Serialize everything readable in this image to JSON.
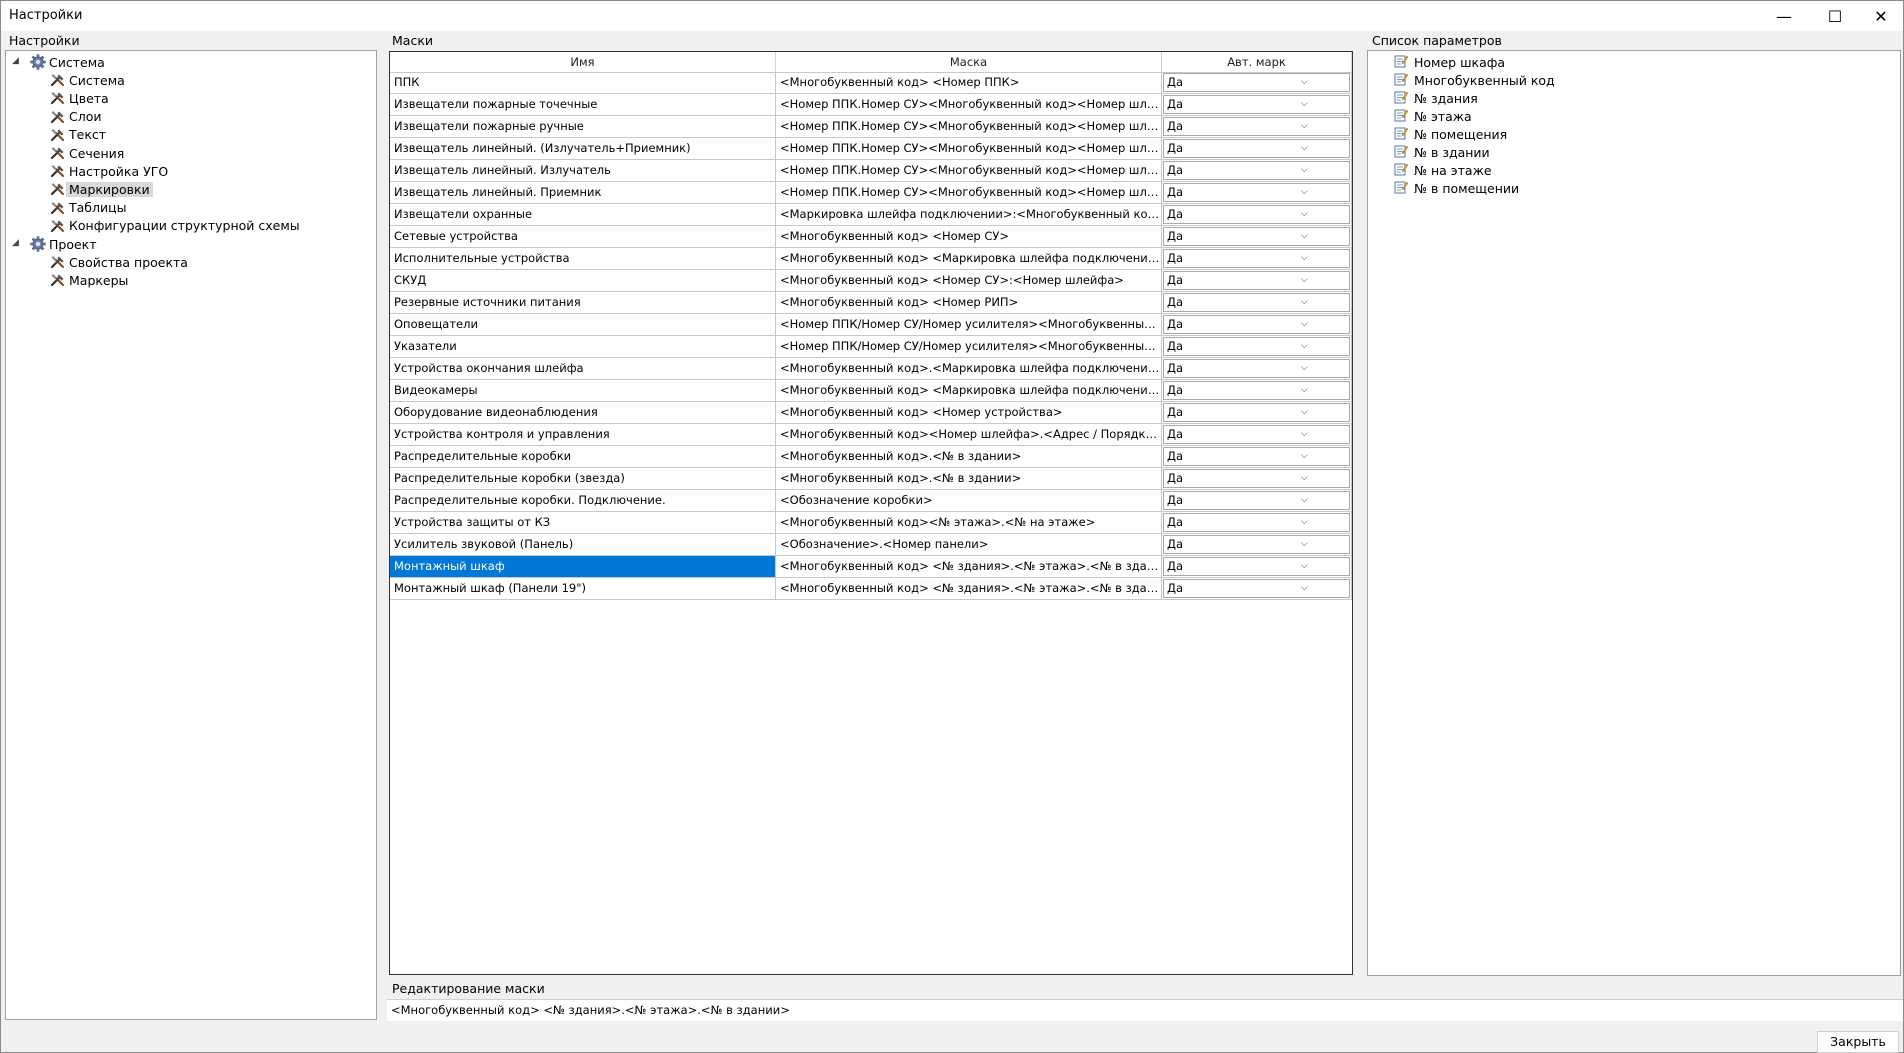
{
  "window": {
    "title": "Настройки",
    "minimize": "—",
    "maximize": "☐",
    "close": "✕"
  },
  "left_panel": {
    "label": "Настройки",
    "tree": [
      {
        "label": "Система",
        "level": 0,
        "icon": "gear-icon",
        "expanded": true
      },
      {
        "label": "Система",
        "level": 1,
        "icon": "tools-icon"
      },
      {
        "label": "Цвета",
        "level": 1,
        "icon": "tools-icon"
      },
      {
        "label": "Слои",
        "level": 1,
        "icon": "tools-icon"
      },
      {
        "label": "Текст",
        "level": 1,
        "icon": "tools-icon"
      },
      {
        "label": "Сечения",
        "level": 1,
        "icon": "tools-icon"
      },
      {
        "label": "Настройка УГО",
        "level": 1,
        "icon": "tools-icon"
      },
      {
        "label": "Маркировки",
        "level": 1,
        "icon": "tools-icon",
        "selected": true
      },
      {
        "label": "Таблицы",
        "level": 1,
        "icon": "tools-icon"
      },
      {
        "label": "Конфигурации структурной схемы",
        "level": 1,
        "icon": "tools-icon"
      },
      {
        "label": "Проект",
        "level": 0,
        "icon": "gear-icon",
        "expanded": true
      },
      {
        "label": "Свойства проекта",
        "level": 1,
        "icon": "tools-icon"
      },
      {
        "label": "Маркеры",
        "level": 1,
        "icon": "tools-icon"
      }
    ]
  },
  "masks": {
    "label": "Маски",
    "columns": [
      "Имя",
      "Маска",
      "Авт. марк"
    ],
    "selected_index": 22,
    "rows": [
      {
        "name": "ППК",
        "mask": "<Многобуквенный код> <Номер ППК>",
        "auto": "Да"
      },
      {
        "name": "Извещатели пожарные точечные",
        "mask": "<Номер ППК.Номер СУ><Многобуквенный код><Номер шлейфа>.<Адр...",
        "auto": "Да"
      },
      {
        "name": "Извещатели пожарные ручные",
        "mask": "<Номер ППК.Номер СУ><Многобуквенный код><Номер шлейфа>.<Адр...",
        "auto": "Да"
      },
      {
        "name": "Извещатель линейный. (Излучатель+Приемник)",
        "mask": "<Номер ППК.Номер СУ><Многобуквенный код><Номер шлейфа>.<Адр...",
        "auto": "Да"
      },
      {
        "name": "Извещатель линейный. Излучатель",
        "mask": "<Номер ППК.Номер СУ><Многобуквенный код><Номер шлейфа>.<Адр...",
        "auto": "Да"
      },
      {
        "name": "Извещатель линейный. Приемник",
        "mask": "<Номер ППК.Номер СУ><Многобуквенный код><Номер шлейфа>.<Адр...",
        "auto": "Да"
      },
      {
        "name": "Извещатели охранные",
        "mask": "<Маркировка шлейфа подключении>:<Многобуквенный код>.<Адрес / ...",
        "auto": "Да"
      },
      {
        "name": "Сетевые устройства",
        "mask": "<Многобуквенный код> <Номер СУ>",
        "auto": "Да"
      },
      {
        "name": "Исполнительные устройства",
        "mask": "<Многобуквенный код> <Маркировка шлейфа подключении>",
        "auto": "Да"
      },
      {
        "name": "СКУД",
        "mask": "<Многобуквенный код> <Номер СУ>:<Номер шлейфа>",
        "auto": "Да"
      },
      {
        "name": "Резервные источники питания",
        "mask": "<Многобуквенный код> <Номер РИП>",
        "auto": "Да"
      },
      {
        "name": "Оповещатели",
        "mask": "<Номер ППК/Номер СУ/Номер усилителя><Многобуквенный код><Но...",
        "auto": "Да"
      },
      {
        "name": "Указатели",
        "mask": "<Номер ППК/Номер СУ/Номер усилителя><Многобуквенный код><Но...",
        "auto": "Да"
      },
      {
        "name": "Устройства окончания шлейфа",
        "mask": "<Многобуквенный код>.<Маркировка шлейфа подключении>.<№ в здан...",
        "auto": "Да"
      },
      {
        "name": "Видеокамеры",
        "mask": "<Многобуквенный код> <Маркировка шлейфа подключении>",
        "auto": "Да"
      },
      {
        "name": "Оборудование видеонаблюдения",
        "mask": "<Многобуквенный код> <Номер устройства>",
        "auto": "Да"
      },
      {
        "name": "Устройства контроля и управления",
        "mask": "<Многобуквенный код><Номер шлейфа>.<Адрес / Порядковый номер в...",
        "auto": "Да"
      },
      {
        "name": "Распределительные коробки",
        "mask": "<Многобуквенный код>.<№ в здании>",
        "auto": "Да"
      },
      {
        "name": "Распределительные коробки (звезда)",
        "mask": "<Многобуквенный код>.<№ в здании>",
        "auto": "Да"
      },
      {
        "name": "Распределительные коробки. Подключение.",
        "mask": "<Обозначение коробки>",
        "auto": "Да"
      },
      {
        "name": "Устройства защиты от КЗ",
        "mask": "<Многобуквенный код><№ этажа>.<№ на этаже>",
        "auto": "Да"
      },
      {
        "name": "Усилитель звуковой (Панель)",
        "mask": "<Обозначение>.<Номер панели>",
        "auto": "Да"
      },
      {
        "name": "Монтажный шкаф",
        "mask": "<Многобуквенный код> <№ здания>.<№ этажа>.<№ в здании>",
        "auto": "Да"
      },
      {
        "name": "Монтажный шкаф (Панели 19\")",
        "mask": "<Многобуквенный код> <№ здания>.<№ этажа>.<№ в здании>",
        "auto": "Да"
      }
    ]
  },
  "params": {
    "label": "Список параметров",
    "items": [
      "Номер шкафа",
      "Многобуквенный код",
      "№ здания",
      "№ этажа",
      "№ помещения",
      "№ в здании",
      "№ на этаже",
      "№ в помещении"
    ]
  },
  "edit_mask": {
    "label": "Редактирование маски",
    "value": "<Многобуквенный код> <№ здания>.<№ этажа>.<№ в здании>"
  },
  "footer": {
    "close_label": "Закрыть"
  },
  "colors": {
    "selection": "#0078d7",
    "tree_selection": "#d9d9d9"
  }
}
